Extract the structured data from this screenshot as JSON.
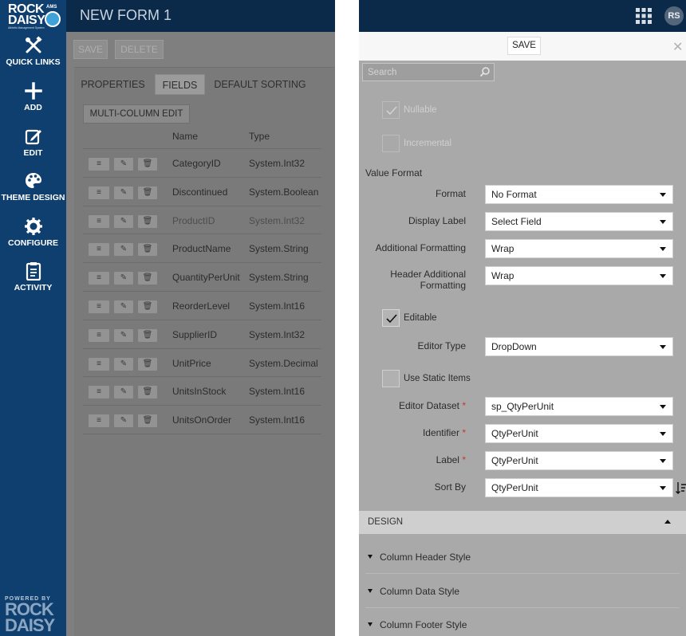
{
  "sidebar": {
    "logo": {
      "rock": "ROCK",
      "daisy": "DAISY",
      "ams": "AMS",
      "subtitle": "Athletic Management System"
    },
    "items": [
      {
        "label": "QUICK LINKS",
        "icon": "wrench-screwdriver-icon"
      },
      {
        "label": "ADD",
        "icon": "plus-icon"
      },
      {
        "label": "EDIT",
        "icon": "edit-icon"
      },
      {
        "label": "THEME DESIGN",
        "icon": "palette-icon"
      },
      {
        "label": "CONFIGURE",
        "icon": "gear-icon"
      },
      {
        "label": "ACTIVITY",
        "icon": "clipboard-icon"
      }
    ],
    "powered": {
      "by": "POWERED BY",
      "rock": "ROCK",
      "daisy": "DAISY"
    }
  },
  "left": {
    "title": "NEW FORM 1",
    "toolbar": {
      "save": "SAVE",
      "delete": "DELETE"
    },
    "tabs": [
      {
        "label": "PROPERTIES"
      },
      {
        "label": "FIELDS",
        "active": true
      },
      {
        "label": "DEFAULT SORTING"
      }
    ],
    "multi_column_edit": "MULTI-COLUMN EDIT",
    "columns": {
      "name": "Name",
      "type": "Type"
    },
    "rows": [
      {
        "name": "CategoryID",
        "type": "System.Int32"
      },
      {
        "name": "Discontinued",
        "type": "System.Boolean"
      },
      {
        "name": "ProductID",
        "type": "System.Int32"
      },
      {
        "name": "ProductName",
        "type": "System.String"
      },
      {
        "name": "QuantityPerUnit",
        "type": "System.String"
      },
      {
        "name": "ReorderLevel",
        "type": "System.Int16"
      },
      {
        "name": "SupplierID",
        "type": "System.Int32"
      },
      {
        "name": "UnitPrice",
        "type": "System.Decimal"
      },
      {
        "name": "UnitsInStock",
        "type": "System.Int16"
      },
      {
        "name": "UnitsOnOrder",
        "type": "System.Int16"
      }
    ]
  },
  "right": {
    "avatar": "RS",
    "save": "SAVE",
    "search": {
      "placeholder": "Search"
    },
    "nullable": "Nullable",
    "incremental": "Incremental",
    "value_format": "Value Format",
    "fields": {
      "format": {
        "label": "Format",
        "value": "No Format"
      },
      "display_label": {
        "label": "Display Label",
        "value": "Select Field"
      },
      "additional_formatting": {
        "label": "Additional Formatting",
        "value": "Wrap"
      },
      "header_additional_formatting": {
        "label1": "Header Additional",
        "label2": "Formatting",
        "value": "Wrap"
      },
      "editor_type": {
        "label": "Editor Type",
        "value": "DropDown"
      },
      "editor_dataset": {
        "label": "Editor Dataset",
        "value": "sp_QtyPerUnit"
      },
      "identifier": {
        "label": "Identifier",
        "value": "QtyPerUnit"
      },
      "field_label": {
        "label": "Label",
        "value": "QtyPerUnit"
      },
      "sort_by": {
        "label": "Sort By",
        "value": "QtyPerUnit"
      }
    },
    "editable": "Editable",
    "use_static_items": "Use Static Items",
    "required_mark": "*",
    "design": "DESIGN",
    "accordion": [
      {
        "label": "Column Header Style"
      },
      {
        "label": "Column Data Style"
      },
      {
        "label": "Column Footer Style"
      }
    ]
  }
}
